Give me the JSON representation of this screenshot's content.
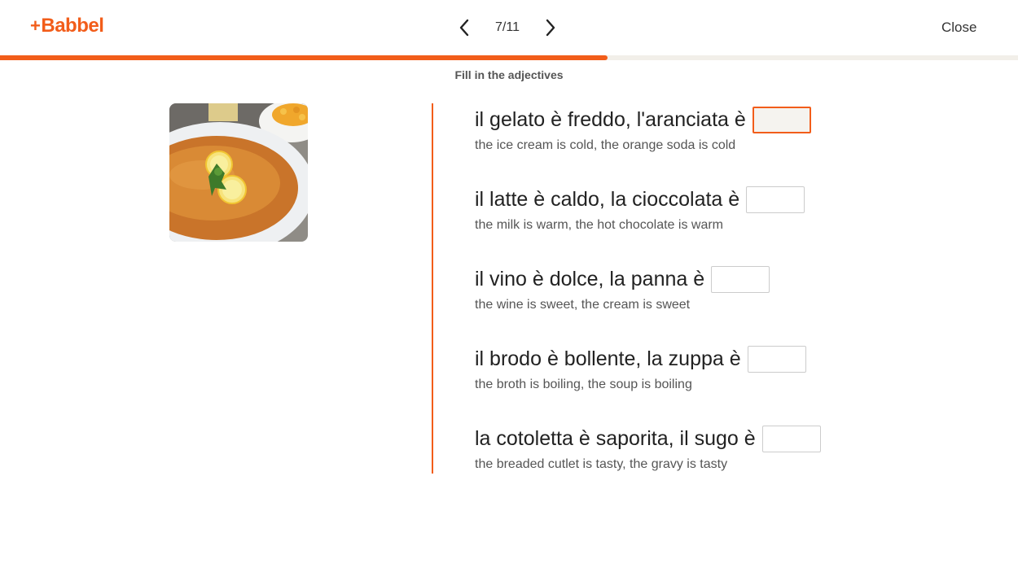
{
  "header": {
    "logo_text": "Babbel",
    "logo_plus": "+",
    "counter": "7/11",
    "close_label": "Close",
    "brand_color": "#f25d1a"
  },
  "progress": {
    "fraction": 0.597
  },
  "instruction": "Fill in the adjectives",
  "image": {
    "subject": "breaded cutlet with lemon slices and parsley, fries in the background"
  },
  "items": [
    {
      "sentence": "il gelato è freddo, l'aranciata è",
      "translation": "the ice cream is cold, the orange soda is cold",
      "answer": "",
      "active": true
    },
    {
      "sentence": "il latte è caldo, la cioccolata è",
      "translation": "the milk is warm, the hot chocolate is warm",
      "answer": "",
      "active": false
    },
    {
      "sentence": "il vino è dolce, la panna è",
      "translation": "the wine is sweet, the cream is sweet",
      "answer": "",
      "active": false
    },
    {
      "sentence": "il brodo è bollente, la zuppa è",
      "translation": "the broth is boiling, the soup is boiling",
      "answer": "",
      "active": false
    },
    {
      "sentence": "la cotoletta è saporita, il sugo è",
      "translation": "the breaded cutlet is tasty, the gravy is tasty",
      "answer": "",
      "active": false
    }
  ]
}
